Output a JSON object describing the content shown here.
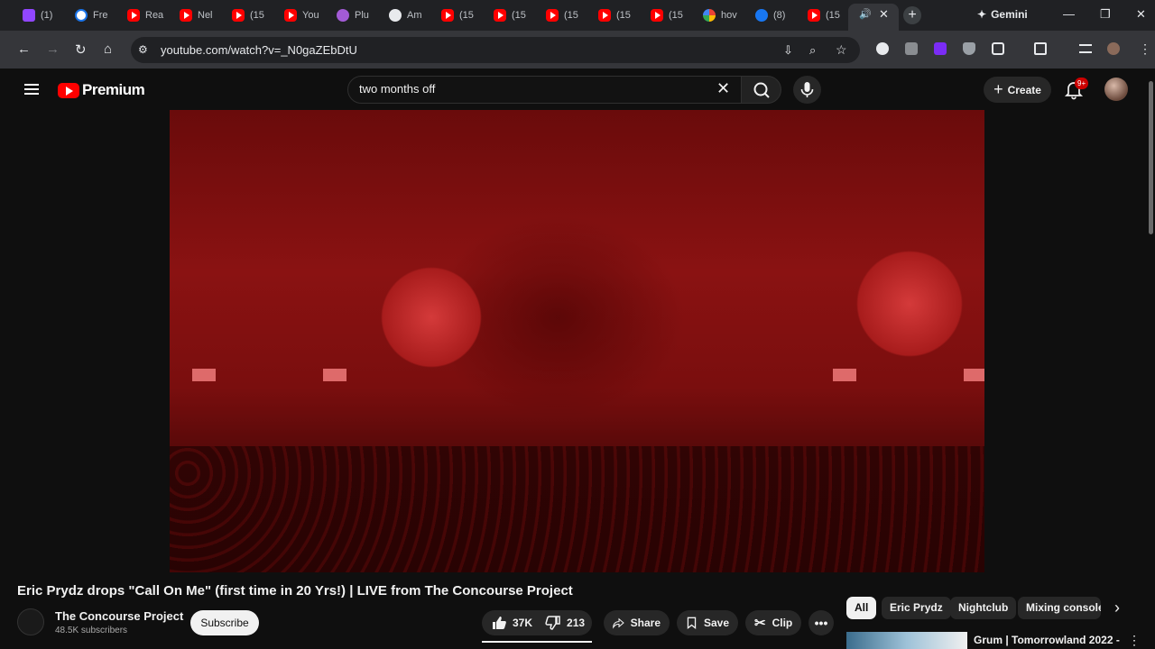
{
  "browser": {
    "tabs": [
      {
        "icon": "twitch-icon",
        "label": "(1)"
      },
      {
        "icon": "j-icon",
        "label": "Fre"
      },
      {
        "icon": "youtube-icon",
        "label": "Rea"
      },
      {
        "icon": "youtube-icon",
        "label": "Nel"
      },
      {
        "icon": "youtube-icon",
        "label": "(15"
      },
      {
        "icon": "youtube-icon",
        "label": "You"
      },
      {
        "icon": "plus-icon",
        "label": "Plu"
      },
      {
        "icon": "at-icon",
        "label": "Am"
      },
      {
        "icon": "youtube-icon",
        "label": "(15"
      },
      {
        "icon": "youtube-icon",
        "label": "(15"
      },
      {
        "icon": "youtube-icon",
        "label": "(15"
      },
      {
        "icon": "youtube-icon",
        "label": "(15"
      },
      {
        "icon": "youtube-icon",
        "label": "(15"
      },
      {
        "icon": "google-icon",
        "label": "hov"
      },
      {
        "icon": "facebook-icon",
        "label": "(8)"
      },
      {
        "icon": "youtube-icon",
        "label": "(15"
      }
    ],
    "gemini_label": "Gemini",
    "url": "youtube.com/watch?v=_N0gaZEbDtU"
  },
  "yt": {
    "logo_text": "Premium",
    "search_value": "two months off",
    "create_label": "Create",
    "notif_badge": "9+"
  },
  "video": {
    "title": "Eric Prydz drops \"Call On Me\" (first time in 20 Yrs!) | LIVE from The Concourse Project",
    "channel_name": "The Concourse Project",
    "channel_subs": "48.5K subscribers",
    "subscribe_label": "Subscribe",
    "likes": "37K",
    "dislikes": "213",
    "share_label": "Share",
    "save_label": "Save",
    "clip_label": "Clip"
  },
  "chips": [
    "All",
    "Eric Prydz",
    "Nightclub",
    "Mixing console"
  ],
  "recommendation": {
    "title": "Grum | Tomorrowland 2022 -"
  }
}
